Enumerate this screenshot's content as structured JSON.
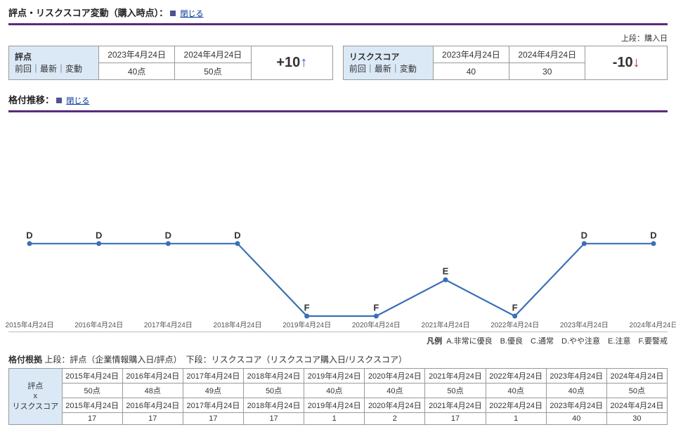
{
  "section1": {
    "title": "評点・リスクスコア変動（購入時点）：",
    "close": "閉じる",
    "top_right": "上段：購入日",
    "hyoten_header": "評点",
    "risk_header": "リスクスコア",
    "sub_header": "前回｜最新｜変動",
    "prev_date": "2023年4月24日",
    "latest_date": "2024年4月24日",
    "hyoten_prev": "40点",
    "hyoten_latest": "50点",
    "hyoten_delta": "+10",
    "risk_prev": "40",
    "risk_latest": "30",
    "risk_delta": "-10"
  },
  "section2": {
    "title": "格付推移：",
    "close": "閉じる"
  },
  "chart_data": {
    "type": "line",
    "x": [
      "2015年4月24日",
      "2016年4月24日",
      "2017年4月24日",
      "2018年4月24日",
      "2019年4月24日",
      "2020年4月24日",
      "2021年4月24日",
      "2022年4月24日",
      "2023年4月24日",
      "2024年4月24日"
    ],
    "grades": [
      "D",
      "D",
      "D",
      "D",
      "F",
      "F",
      "E",
      "F",
      "D",
      "D"
    ],
    "grade_scale": [
      "A",
      "B",
      "C",
      "D",
      "E",
      "F"
    ],
    "legend_title": "凡例",
    "legend_text": "A.非常に優良　B.優良　C.通常　D.やや注意　E.注意　F.要警戒"
  },
  "table": {
    "title_prefix": "格付根拠",
    "title_rest": " 上段：評点（企業情報購入日/評点）　下段：リスクスコア（リスクスコア購入日/リスクスコア）",
    "row_header": "評点\nx\nリスクスコア",
    "dates": [
      "2015年4月24日",
      "2016年4月24日",
      "2017年4月24日",
      "2018年4月24日",
      "2019年4月24日",
      "2020年4月24日",
      "2021年4月24日",
      "2022年4月24日",
      "2023年4月24日",
      "2024年4月24日"
    ],
    "hyoten": [
      "50点",
      "48点",
      "49点",
      "50点",
      "40点",
      "40点",
      "50点",
      "40点",
      "40点",
      "50点"
    ],
    "risk_dates": [
      "2015年4月24日",
      "2016年4月24日",
      "2017年4月24日",
      "2018年4月24日",
      "2019年4月24日",
      "2020年4月24日",
      "2021年4月24日",
      "2022年4月24日",
      "2023年4月24日",
      "2024年4月24日"
    ],
    "risk": [
      "17",
      "17",
      "17",
      "17",
      "1",
      "2",
      "17",
      "1",
      "40",
      "30"
    ]
  }
}
